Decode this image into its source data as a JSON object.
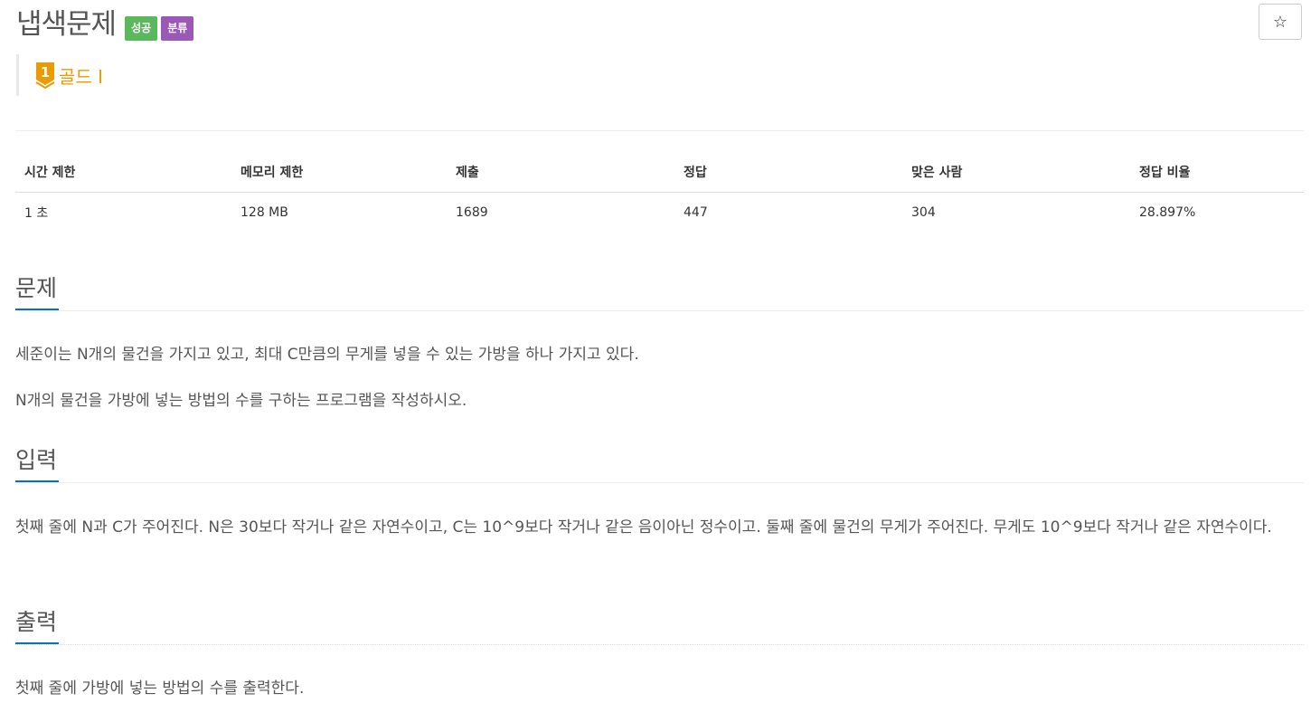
{
  "problem": {
    "title": "냅색문제",
    "badges": [
      {
        "label": "성공",
        "color": "#5cb85c"
      },
      {
        "label": "분류",
        "color": "#9b59b6"
      }
    ],
    "star_icon": "star-outline-icon",
    "star_glyph": "☆",
    "tier": {
      "icon": "gold-1-tier-icon",
      "icon_number": "1",
      "label": "골드 I",
      "color": "#ec9a00"
    }
  },
  "info_table": {
    "headers": [
      "시간 제한",
      "메모리 제한",
      "제출",
      "정답",
      "맞은 사람",
      "정답 비율"
    ],
    "values": [
      "1 초",
      "128 MB",
      "1689",
      "447",
      "304",
      "28.897%"
    ]
  },
  "sections": {
    "description": {
      "title": "문제",
      "paragraphs": [
        "세준이는 N개의 물건을 가지고 있고, 최대 C만큼의 무게를 넣을 수 있는 가방을 하나 가지고 있다.",
        "N개의 물건을 가방에 넣는 방법의 수를 구하는 프로그램을 작성하시오."
      ]
    },
    "input": {
      "title": "입력",
      "paragraphs": [
        "첫째 줄에 N과 C가 주어진다. N은 30보다 작거나 같은 자연수이고, C는 10^9보다 작거나 같은 음이아닌 정수이고. 둘째 줄에 물건의 무게가 주어진다. 무게도 10^9보다 작거나 같은 자연수이다."
      ]
    },
    "output": {
      "title": "출력",
      "paragraphs": [
        "첫째 줄에 가방에 넣는 방법의 수를 출력한다."
      ]
    }
  },
  "colors": {
    "accent": "#0076c0",
    "success": "#5cb85c",
    "category": "#9b59b6",
    "gold": "#ec9a00"
  }
}
